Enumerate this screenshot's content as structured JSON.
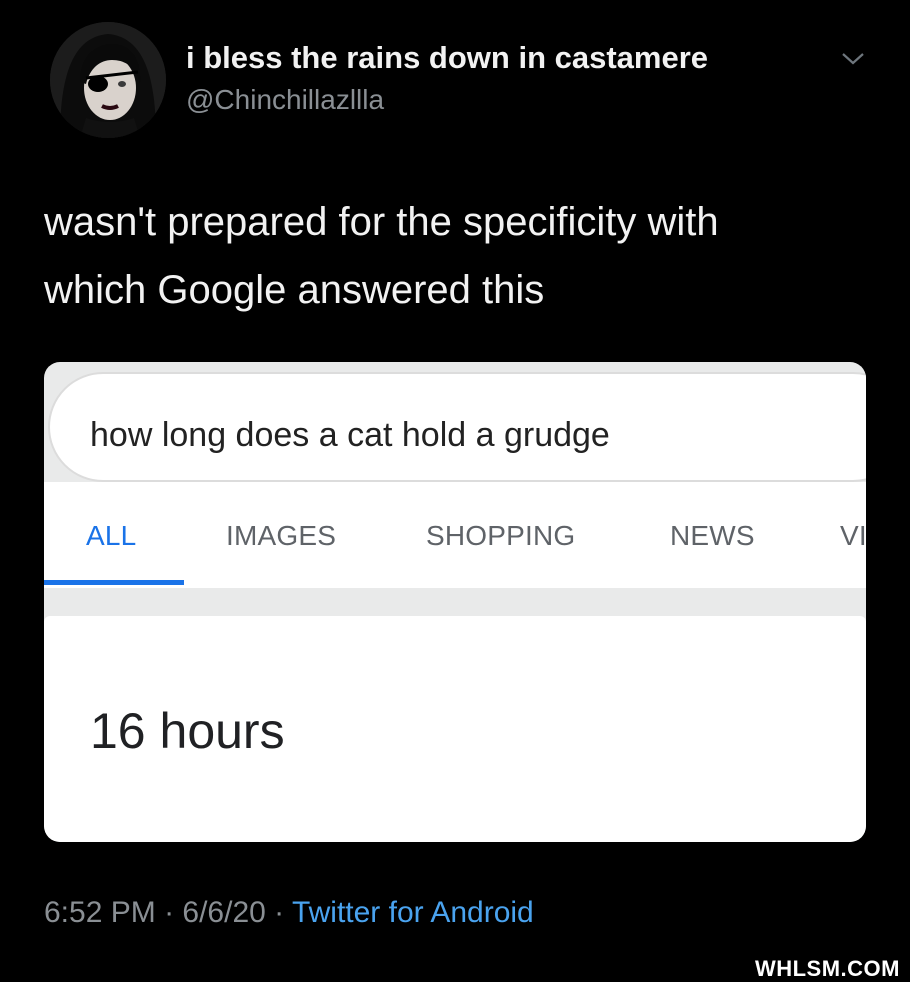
{
  "header": {
    "display_name": "i bless the rains down in castamere",
    "handle": "@Chinchillazllla",
    "menu_icon": "chevron-down-icon"
  },
  "tweet": {
    "line1": "wasn't prepared for the specificity with",
    "line2": "which Google answered this"
  },
  "search_card": {
    "query": "how long does a cat hold a grudge",
    "tabs": [
      "ALL",
      "IMAGES",
      "SHOPPING",
      "NEWS",
      "VI"
    ],
    "active_tab": "ALL",
    "answer": "16 hours",
    "accent_color": "#1a73e8"
  },
  "footer": {
    "time": "6:52 PM",
    "separator": " · ",
    "date": "6/6/20",
    "source": "Twitter for Android",
    "source_color": "#4aa3ef"
  },
  "watermark": "WHLSM.COM"
}
